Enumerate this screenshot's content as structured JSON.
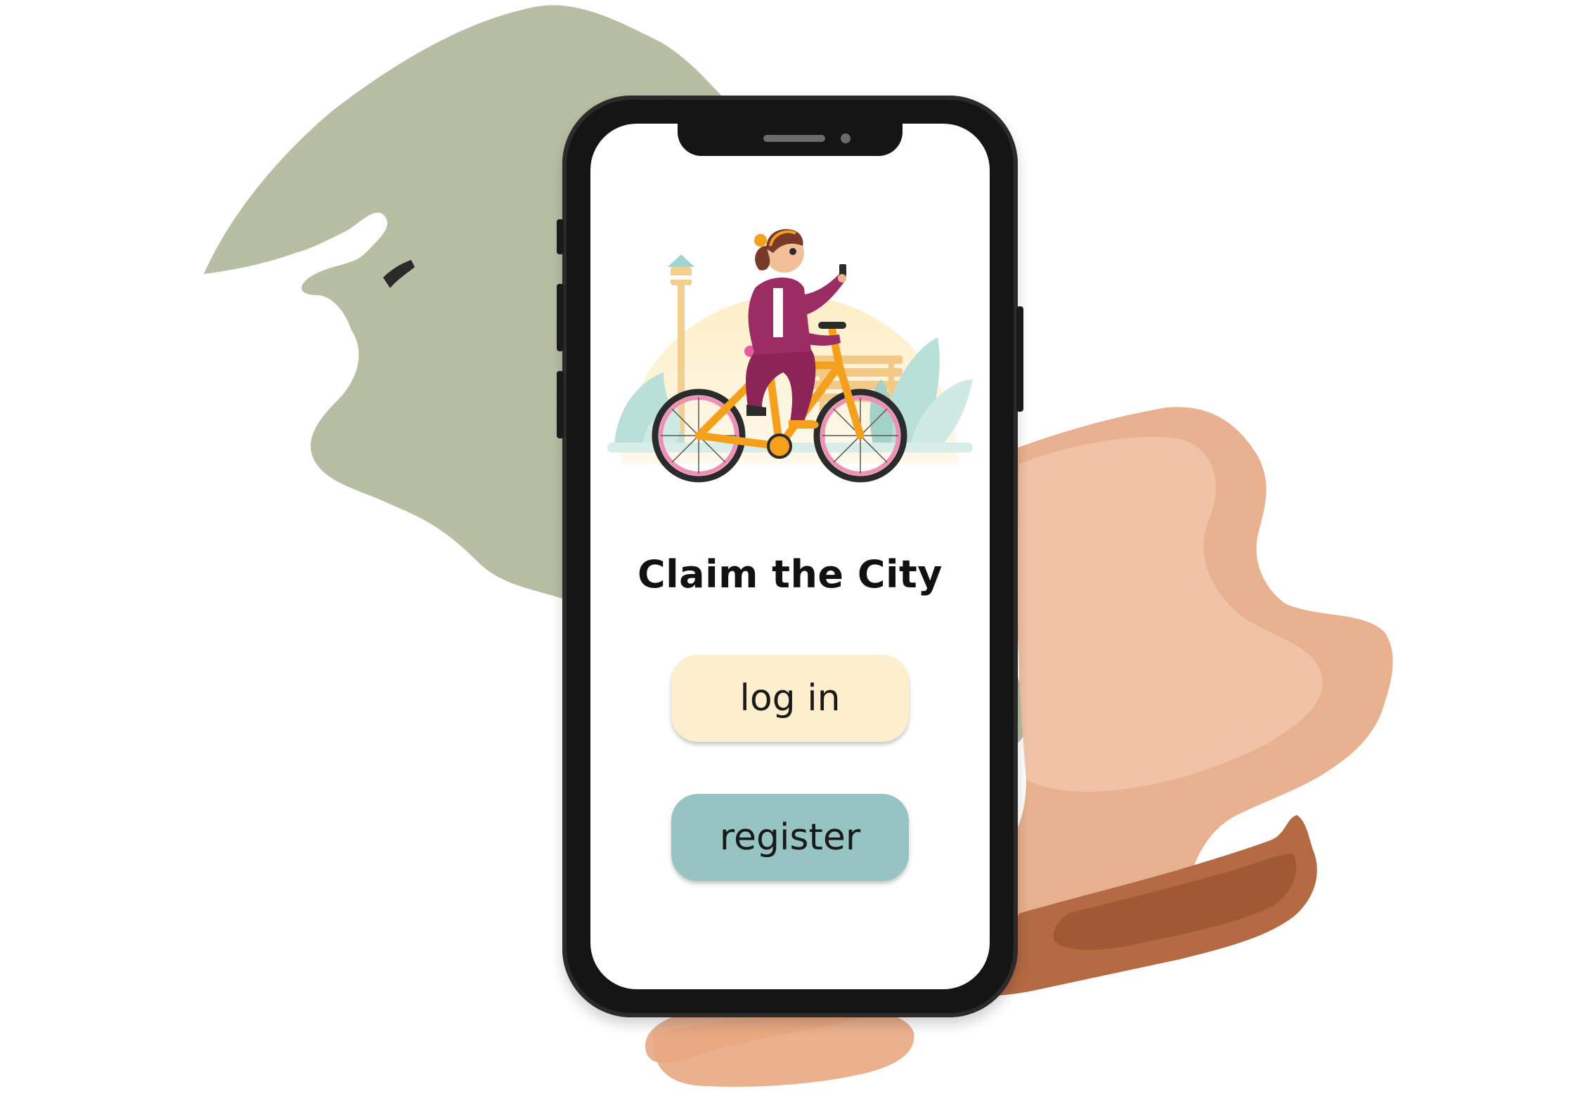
{
  "app": {
    "title": "Claim the City"
  },
  "actions": {
    "login_label": "log in",
    "register_label": "register"
  },
  "colors": {
    "login_button": "#fdefcd",
    "register_button": "#95c4c3",
    "phone_frame": "#151515",
    "sage_wash": "#b9c1a7",
    "peach_wash": "#e7ad8c",
    "rust_wash": "#b7704a"
  },
  "illustration": {
    "subject": "woman-riding-bicycle-using-phone-icon"
  }
}
